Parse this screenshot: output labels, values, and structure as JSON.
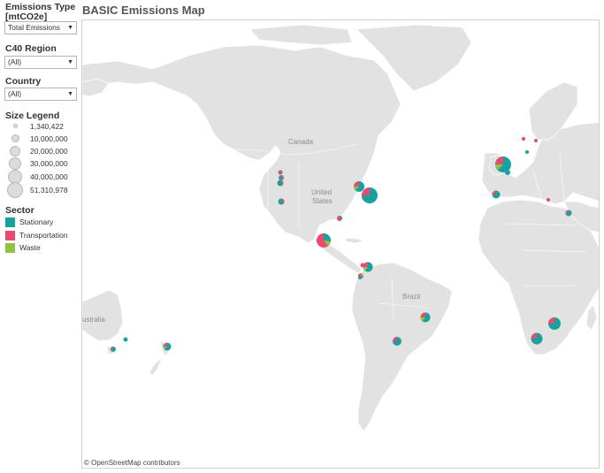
{
  "sidebar": {
    "emissions_type": {
      "title": "Emissions Type\n[mtCO2e]",
      "title_line1": "Emissions Type",
      "title_line2": "[mtCO2e]",
      "value": "Total Emissions"
    },
    "c40_region": {
      "title": "C40 Region",
      "value": "(All)"
    },
    "country": {
      "title": "Country",
      "value": "(All)"
    },
    "size_legend": {
      "title": "Size Legend",
      "items": [
        "1,340,422",
        "10,000,000",
        "20,000,000",
        "30,000,000",
        "40,000,000",
        "51,310,978"
      ]
    },
    "sector_legend": {
      "title": "Sector",
      "items": [
        {
          "label": "Stationary",
          "color": "#17a2a0"
        },
        {
          "label": "Transportation",
          "color": "#e84a72"
        },
        {
          "label": "Waste",
          "color": "#8fc43f"
        }
      ]
    }
  },
  "map": {
    "title": "BASIC Emissions Map",
    "attribution": "© OpenStreetMap contributors",
    "place_labels": {
      "canada": "Canada",
      "united": "United",
      "states": "States",
      "brazil": "Brazil",
      "australia": "ustralia"
    },
    "colors": {
      "land": "#e2e2e2",
      "water": "#ffffff",
      "border": "#ffffff"
    }
  }
}
